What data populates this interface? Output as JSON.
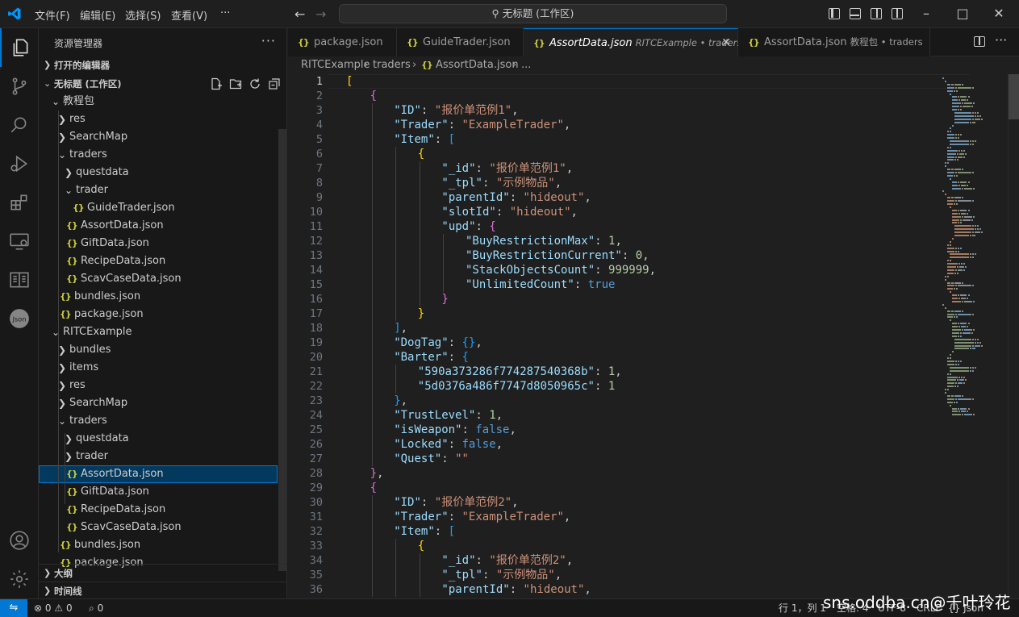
{
  "titlebar": {
    "menus": [
      "文件(F)",
      "编辑(E)",
      "选择(S)",
      "查看(V)",
      "···"
    ],
    "search_text": "无标题 (工作区)"
  },
  "sidebar": {
    "title": "资源管理器",
    "more": "···",
    "open_editors": "打开的编辑器",
    "workspace": "无标题 (工作区)",
    "outline": "大纲",
    "timeline": "时间线",
    "tree": [
      {
        "label": "教程包",
        "depth": 1,
        "kind": "folder",
        "open": true
      },
      {
        "label": "res",
        "depth": 2,
        "kind": "folder",
        "open": false
      },
      {
        "label": "SearchMap",
        "depth": 2,
        "kind": "folder",
        "open": false
      },
      {
        "label": "traders",
        "depth": 2,
        "kind": "folder",
        "open": true
      },
      {
        "label": "questdata",
        "depth": 3,
        "kind": "folder",
        "open": false
      },
      {
        "label": "trader",
        "depth": 3,
        "kind": "folder",
        "open": true
      },
      {
        "label": "GuideTrader.json",
        "depth": 4,
        "kind": "file"
      },
      {
        "label": "AssortData.json",
        "depth": 3,
        "kind": "file"
      },
      {
        "label": "GiftData.json",
        "depth": 3,
        "kind": "file"
      },
      {
        "label": "RecipeData.json",
        "depth": 3,
        "kind": "file"
      },
      {
        "label": "ScavCaseData.json",
        "depth": 3,
        "kind": "file"
      },
      {
        "label": "bundles.json",
        "depth": 2,
        "kind": "file"
      },
      {
        "label": "package.json",
        "depth": 2,
        "kind": "file"
      },
      {
        "label": "RITCExample",
        "depth": 1,
        "kind": "folder",
        "open": true
      },
      {
        "label": "bundles",
        "depth": 2,
        "kind": "folder",
        "open": false
      },
      {
        "label": "items",
        "depth": 2,
        "kind": "folder",
        "open": false
      },
      {
        "label": "res",
        "depth": 2,
        "kind": "folder",
        "open": false
      },
      {
        "label": "SearchMap",
        "depth": 2,
        "kind": "folder",
        "open": false
      },
      {
        "label": "traders",
        "depth": 2,
        "kind": "folder",
        "open": true
      },
      {
        "label": "questdata",
        "depth": 3,
        "kind": "folder",
        "open": false
      },
      {
        "label": "trader",
        "depth": 3,
        "kind": "folder",
        "open": false
      },
      {
        "label": "AssortData.json",
        "depth": 3,
        "kind": "file",
        "selected": true
      },
      {
        "label": "GiftData.json",
        "depth": 3,
        "kind": "file"
      },
      {
        "label": "RecipeData.json",
        "depth": 3,
        "kind": "file"
      },
      {
        "label": "ScavCaseData.json",
        "depth": 3,
        "kind": "file"
      },
      {
        "label": "bundles.json",
        "depth": 2,
        "kind": "file"
      },
      {
        "label": "package.json",
        "depth": 2,
        "kind": "file"
      }
    ]
  },
  "tabs": [
    {
      "label": "package.json",
      "desc": "",
      "active": false
    },
    {
      "label": "GuideTrader.json",
      "desc": "",
      "active": false
    },
    {
      "label": "AssortData.json",
      "desc": "RITCExample • traders",
      "active": true
    },
    {
      "label": "AssortData.json",
      "desc": "教程包 • traders",
      "active": false
    }
  ],
  "breadcrumb": [
    "RITCExample",
    "traders",
    "AssortData.json",
    "..."
  ],
  "editor": {
    "start_line": 1,
    "current_line": 1,
    "lines": [
      [
        [
          0,
          "b1",
          "["
        ]
      ],
      [
        [
          1,
          "b2",
          "{"
        ]
      ],
      [
        [
          2,
          "t-key",
          "\"ID\""
        ],
        [
          0,
          "t-p",
          ": "
        ],
        [
          0,
          "t-str",
          "\"报价单范例1\""
        ],
        [
          0,
          "t-p",
          ","
        ]
      ],
      [
        [
          2,
          "t-key",
          "\"Trader\""
        ],
        [
          0,
          "t-p",
          ": "
        ],
        [
          0,
          "t-str",
          "\"ExampleTrader\""
        ],
        [
          0,
          "t-p",
          ","
        ]
      ],
      [
        [
          2,
          "t-key",
          "\"Item\""
        ],
        [
          0,
          "t-p",
          ": "
        ],
        [
          0,
          "b3",
          "["
        ]
      ],
      [
        [
          3,
          "b1",
          "{"
        ]
      ],
      [
        [
          4,
          "t-key",
          "\"_id\""
        ],
        [
          0,
          "t-p",
          ": "
        ],
        [
          0,
          "t-str",
          "\"报价单范例1\""
        ],
        [
          0,
          "t-p",
          ","
        ]
      ],
      [
        [
          4,
          "t-key",
          "\"_tpl\""
        ],
        [
          0,
          "t-p",
          ": "
        ],
        [
          0,
          "t-str",
          "\"示例物品\""
        ],
        [
          0,
          "t-p",
          ","
        ]
      ],
      [
        [
          4,
          "t-key",
          "\"parentId\""
        ],
        [
          0,
          "t-p",
          ": "
        ],
        [
          0,
          "t-str",
          "\"hideout\""
        ],
        [
          0,
          "t-p",
          ","
        ]
      ],
      [
        [
          4,
          "t-key",
          "\"slotId\""
        ],
        [
          0,
          "t-p",
          ": "
        ],
        [
          0,
          "t-str",
          "\"hideout\""
        ],
        [
          0,
          "t-p",
          ","
        ]
      ],
      [
        [
          4,
          "t-key",
          "\"upd\""
        ],
        [
          0,
          "t-p",
          ": "
        ],
        [
          0,
          "b2",
          "{"
        ]
      ],
      [
        [
          5,
          "t-key",
          "\"BuyRestrictionMax\""
        ],
        [
          0,
          "t-p",
          ": "
        ],
        [
          0,
          "t-num",
          "1"
        ],
        [
          0,
          "t-p",
          ","
        ]
      ],
      [
        [
          5,
          "t-key",
          "\"BuyRestrictionCurrent\""
        ],
        [
          0,
          "t-p",
          ": "
        ],
        [
          0,
          "t-num",
          "0"
        ],
        [
          0,
          "t-p",
          ","
        ]
      ],
      [
        [
          5,
          "t-key",
          "\"StackObjectsCount\""
        ],
        [
          0,
          "t-p",
          ": "
        ],
        [
          0,
          "t-num",
          "999999"
        ],
        [
          0,
          "t-p",
          ","
        ]
      ],
      [
        [
          5,
          "t-key",
          "\"UnlimitedCount\""
        ],
        [
          0,
          "t-p",
          ": "
        ],
        [
          0,
          "t-kw",
          "true"
        ]
      ],
      [
        [
          4,
          "b2",
          "}"
        ]
      ],
      [
        [
          3,
          "b1",
          "}"
        ]
      ],
      [
        [
          2,
          "b3",
          "]"
        ],
        [
          0,
          "t-p",
          ","
        ]
      ],
      [
        [
          2,
          "t-key",
          "\"DogTag\""
        ],
        [
          0,
          "t-p",
          ": "
        ],
        [
          0,
          "b3",
          "{}"
        ],
        [
          0,
          "t-p",
          ","
        ]
      ],
      [
        [
          2,
          "t-key",
          "\"Barter\""
        ],
        [
          0,
          "t-p",
          ": "
        ],
        [
          0,
          "b3",
          "{"
        ]
      ],
      [
        [
          3,
          "t-key",
          "\"590a373286f774287540368b\""
        ],
        [
          0,
          "t-p",
          ": "
        ],
        [
          0,
          "t-num",
          "1"
        ],
        [
          0,
          "t-p",
          ","
        ]
      ],
      [
        [
          3,
          "t-key",
          "\"5d0376a486f7747d8050965c\""
        ],
        [
          0,
          "t-p",
          ": "
        ],
        [
          0,
          "t-num",
          "1"
        ]
      ],
      [
        [
          2,
          "b3",
          "}"
        ],
        [
          0,
          "t-p",
          ","
        ]
      ],
      [
        [
          2,
          "t-key",
          "\"TrustLevel\""
        ],
        [
          0,
          "t-p",
          ": "
        ],
        [
          0,
          "t-num",
          "1"
        ],
        [
          0,
          "t-p",
          ","
        ]
      ],
      [
        [
          2,
          "t-key",
          "\"isWeapon\""
        ],
        [
          0,
          "t-p",
          ": "
        ],
        [
          0,
          "t-kw",
          "false"
        ],
        [
          0,
          "t-p",
          ","
        ]
      ],
      [
        [
          2,
          "t-key",
          "\"Locked\""
        ],
        [
          0,
          "t-p",
          ": "
        ],
        [
          0,
          "t-kw",
          "false"
        ],
        [
          0,
          "t-p",
          ","
        ]
      ],
      [
        [
          2,
          "t-key",
          "\"Quest\""
        ],
        [
          0,
          "t-p",
          ": "
        ],
        [
          0,
          "t-str",
          "\"\""
        ]
      ],
      [
        [
          1,
          "b2",
          "}"
        ],
        [
          0,
          "t-p",
          ","
        ]
      ],
      [
        [
          1,
          "b2",
          "{"
        ]
      ],
      [
        [
          2,
          "t-key",
          "\"ID\""
        ],
        [
          0,
          "t-p",
          ": "
        ],
        [
          0,
          "t-str",
          "\"报价单范例2\""
        ],
        [
          0,
          "t-p",
          ","
        ]
      ],
      [
        [
          2,
          "t-key",
          "\"Trader\""
        ],
        [
          0,
          "t-p",
          ": "
        ],
        [
          0,
          "t-str",
          "\"ExampleTrader\""
        ],
        [
          0,
          "t-p",
          ","
        ]
      ],
      [
        [
          2,
          "t-key",
          "\"Item\""
        ],
        [
          0,
          "t-p",
          ": "
        ],
        [
          0,
          "b3",
          "["
        ]
      ],
      [
        [
          3,
          "b1",
          "{"
        ]
      ],
      [
        [
          4,
          "t-key",
          "\"_id\""
        ],
        [
          0,
          "t-p",
          ": "
        ],
        [
          0,
          "t-str",
          "\"报价单范例2\""
        ],
        [
          0,
          "t-p",
          ","
        ]
      ],
      [
        [
          4,
          "t-key",
          "\"_tpl\""
        ],
        [
          0,
          "t-p",
          ": "
        ],
        [
          0,
          "t-str",
          "\"示例物品\""
        ],
        [
          0,
          "t-p",
          ","
        ]
      ],
      [
        [
          4,
          "t-key",
          "\"parentId\""
        ],
        [
          0,
          "t-p",
          ": "
        ],
        [
          0,
          "t-str",
          "\"hideout\""
        ],
        [
          0,
          "t-p",
          ","
        ]
      ]
    ]
  },
  "statusbar": {
    "errors": "0",
    "warnings": "0",
    "ports": "0",
    "position": "行 1，列 1",
    "spaces": "空格: 4",
    "encoding": "UTF-8",
    "eol": "CRLF",
    "language": "{} Json",
    "watermark": "sns.oddba.cn@千叶玲花"
  },
  "colors": {
    "accent": "#0078d4",
    "json_icon": "#cbcb41",
    "selection": "#04395e"
  }
}
